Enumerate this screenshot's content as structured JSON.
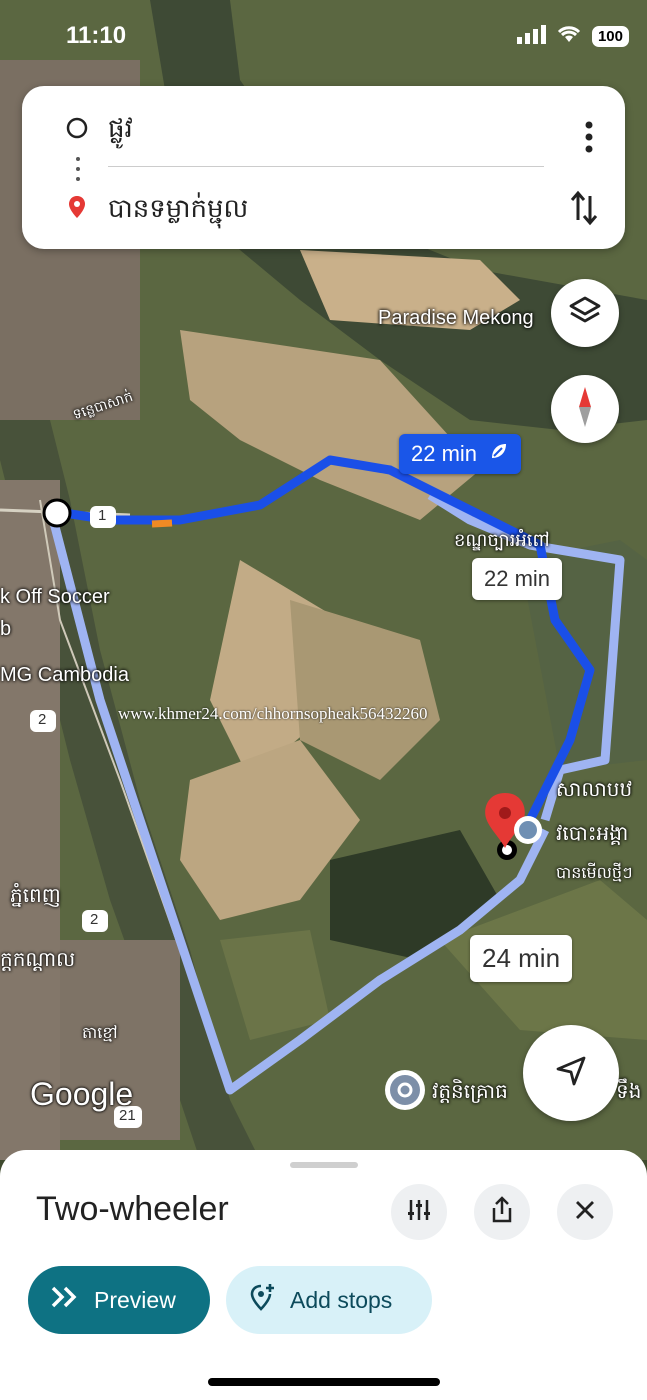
{
  "status_bar": {
    "time": "11:10",
    "battery": "100"
  },
  "search_card": {
    "origin": "ផ្លូវ",
    "destination": "បានទម្លាក់ម្ជុល"
  },
  "map": {
    "labels": {
      "paradise": "Paradise Mekong",
      "road_label": "ទន្លេបាសាក់",
      "soccer": "k Off Soccer",
      "b": "b",
      "mg": "MG Cambodia",
      "district": "ខណ្ឌច្បារអំពៅ",
      "khmer_left1": "ភ្នំពេញ",
      "khmer_left2": "ក្តកណ្ដាល",
      "khmer_left3": "តាខ្មៅ",
      "khmer_right1": "សាលាបឋ",
      "khmer_right2": "វបោះអង្គា",
      "khmer_right3": "បានមើលថ្មីៗ",
      "khmer_right4": "វត្តនិគ្រោធ",
      "khmer_right5": "ទឹង",
      "route1": "1",
      "route2a": "2",
      "route2b": "2",
      "route21": "21"
    },
    "badges": {
      "primary": "22 min",
      "alt1": "22 min",
      "alt2": "24 min"
    },
    "watermark": "www.khmer24.com/chhornsopheak56432260",
    "logo": "Google"
  },
  "sheet": {
    "mode": "Two-wheeler",
    "preview_label": "Preview",
    "add_stops_label": "Add stops"
  },
  "colors": {
    "route_primary": "#1a4fe8",
    "route_alt": "#9fb4f2",
    "preview_bg": "#0e7283",
    "stops_bg": "#d8f1f8",
    "pin": "#e53935"
  }
}
